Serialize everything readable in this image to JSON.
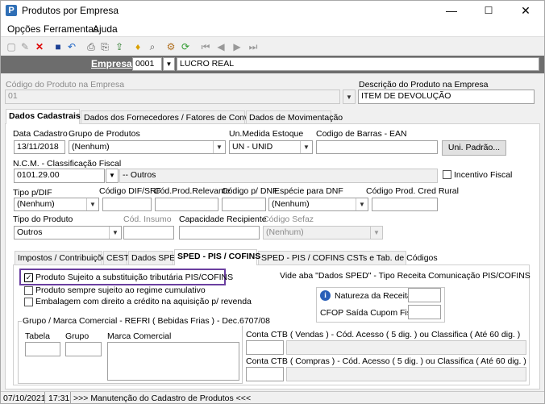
{
  "window": {
    "title": "Produtos por Empresa",
    "app_icon": "P",
    "minimize": "—",
    "maximize": "☐",
    "close": "✕"
  },
  "menu": {
    "items": [
      "Opções",
      "Ferramentas",
      "Ajuda"
    ]
  },
  "empresa": {
    "label": "Empresa",
    "code": "0001",
    "name": "LUCRO REAL"
  },
  "produto": {
    "codigo_label": "Código do Produto na Empresa",
    "codigo": "01",
    "descricao_label": "Descrição do Produto na Empresa",
    "descricao": "ITEM DE DEVOLUÇÃO"
  },
  "main_tabs": [
    "Dados Cadastrais",
    "Dados dos Fornecedores / Fatores de Conversão",
    "Dados de Movimentação"
  ],
  "form": {
    "data_cadastro_label": "Data Cadastro",
    "data_cadastro": "13/11/2018",
    "grupo_label": "Grupo de Produtos",
    "grupo": "(Nenhum)",
    "unmedida_label": "Un.Medida Estoque",
    "unmedida": "UN - UNID",
    "barras_label": "Codigo de Barras - EAN",
    "barras": "",
    "uni_padrao": "Uni. Padrão...",
    "ncm_label": "N.C.M. -  Classificação Fiscal",
    "ncm": "0101.29.00",
    "ncm_desc": "-- Outros",
    "incentivo_label": "Incentivo Fiscal",
    "tipo_dif_label": "Tipo p/DIF",
    "tipo_dif": "(Nenhum)",
    "cod_dif_label": "Código DIF/SRF",
    "cod_prod_rel_label": "Cód.Prod.Relevante",
    "cod_dnf_label": "Código p/ DNF",
    "especie_dnf_label": "Espécie para DNF",
    "especie_dnf": "(Nenhum)",
    "cod_cred_rural_label": "Código Prod. Cred Rural",
    "tipo_produto_label": "Tipo do Produto",
    "tipo_produto": "Outros",
    "cod_insumo_label": "Cód. Insumo",
    "capacidade_label": "Capacidade Recipiente",
    "cod_sefaz_label": "Código Sefaz",
    "cod_sefaz": "(Nenhum)"
  },
  "sub_tabs": [
    "Impostos / Contribuições",
    "CEST",
    "Dados SPED",
    "SPED - PIS / COFINS",
    "SPED - PIS / COFINS CSTs e Tab. de Códigos"
  ],
  "pis": {
    "chk1": "Produto Sujeito a substituição tributária PIS/COFINS",
    "chk2": "Produto sempre sujeito ao regime cumulativo",
    "chk3": "Embalagem com direito a crédito na aquisição p/ revenda",
    "vide_label": "Vide aba \"Dados SPED\" - Tipo Receita Comunicação PIS/COFINS",
    "natureza_label": "Natureza da Receita:",
    "cfop_label": "CFOP Saída Cupom Fiscal:",
    "grupo_title": "Grupo / Marca Comercial - REFRI ( Bebidas Frias ) - Dec.6707/08",
    "tabela_label": "Tabela",
    "grupo_label": "Grupo",
    "marca_label": "Marca Comercial",
    "conta_vendas_label": "Conta CTB ( Vendas ) - Cód. Acesso ( 5 dig. ) ou Classifica ( Até 60 dig. )",
    "conta_compras_label": "Conta CTB ( Compras ) - Cód. Acesso ( 5 dig. ) ou Classifica ( Até 60 dig. )"
  },
  "status": {
    "date": "07/10/2021",
    "time": "17:31",
    "message": ">>> Manutenção do Cadastro de Produtos <<<"
  },
  "colors": {
    "highlight_border": "#6b3fa0",
    "app_icon": "#2f6fb6"
  }
}
